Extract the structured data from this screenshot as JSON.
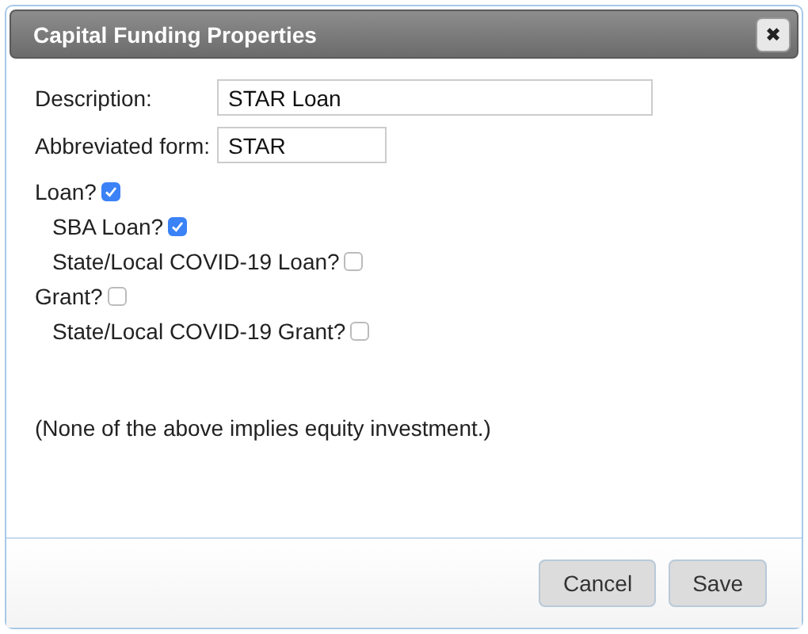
{
  "window": {
    "title": "Capital Funding Properties",
    "close": "✖"
  },
  "fields": [
    {
      "label": "Description:",
      "value": "STAR Loan",
      "wide": true
    },
    {
      "label": "Abbreviated form:",
      "value": "STAR",
      "wide": false
    }
  ],
  "options": [
    {
      "label": "Loan?",
      "checked": true,
      "children": [
        {
          "label": "SBA Loan?",
          "checked": true
        },
        {
          "label": "State/Local COVID-19 Loan?",
          "checked": false
        }
      ]
    },
    {
      "label": "Grant?",
      "checked": false,
      "children": [
        {
          "label": "State/Local COVID-19 Grant?",
          "checked": false
        }
      ]
    }
  ],
  "note": "(None of the above implies equity investment.)",
  "buttons": [
    "Cancel",
    "Save"
  ]
}
